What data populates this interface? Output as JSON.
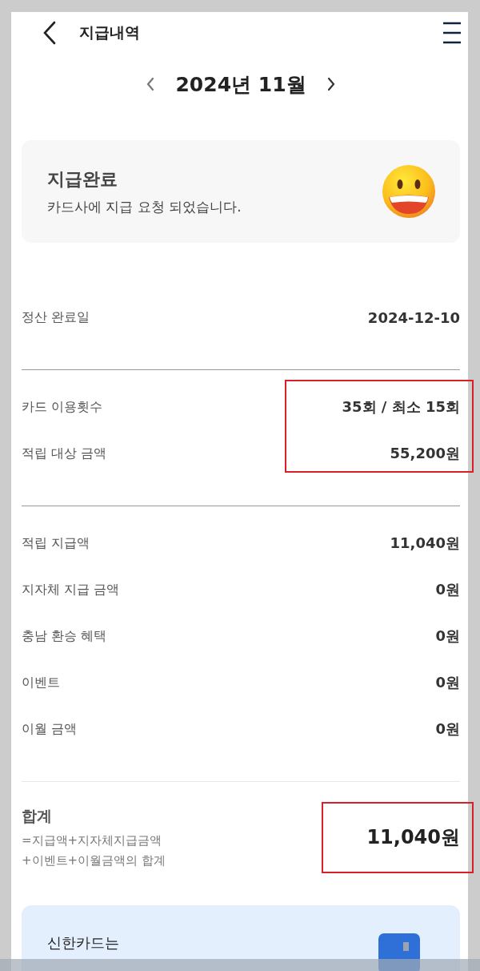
{
  "header": {
    "title": "지급내역"
  },
  "month_nav": {
    "label": "2024년 11월"
  },
  "status_card": {
    "title": "지급완료",
    "message": "카드사에 지급 요청 되었습니다."
  },
  "sections": [
    {
      "highlighted": false,
      "rows": [
        {
          "label": "정산 완료일",
          "value": "2024-12-10"
        }
      ]
    },
    {
      "highlighted": true,
      "rows": [
        {
          "label": "카드 이용횟수",
          "value": "35회 / 최소 15회"
        },
        {
          "label": "적립 대상 금액",
          "value": "55,200원"
        }
      ]
    },
    {
      "highlighted": false,
      "rows": [
        {
          "label": "적립 지급액",
          "value": "11,040원"
        },
        {
          "label": "지자체 지급 금액",
          "value": "0원"
        },
        {
          "label": "충남 환승 혜택",
          "value": "0원"
        },
        {
          "label": "이벤트",
          "value": "0원"
        },
        {
          "label": "이월 금액",
          "value": "0원"
        }
      ]
    }
  ],
  "total": {
    "label": "합계",
    "formula_lines": [
      "=지급액+지자체지급금액",
      "+이벤트+이월금액의 합계"
    ],
    "value": "11,040원",
    "highlighted": true
  },
  "banner": {
    "text": "신한카드는"
  }
}
